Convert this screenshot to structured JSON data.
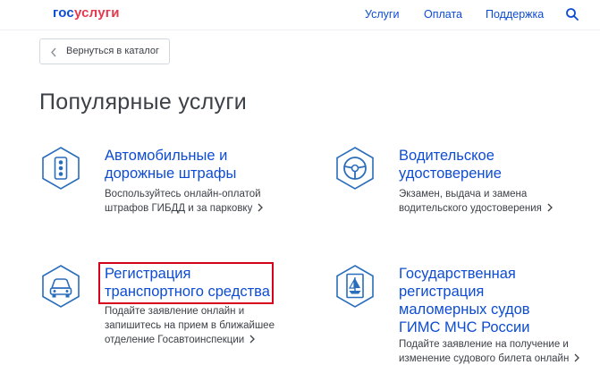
{
  "header": {
    "logo_part1": "гос",
    "logo_part2": "услуги",
    "nav": [
      "Услуги",
      "Оплата",
      "Поддержка"
    ]
  },
  "back_button": {
    "label": "Вернуться в каталог"
  },
  "page_title": "Популярные услуги",
  "services": [
    {
      "icon": "traffic-light-icon",
      "title_lines": [
        "Автомобильные и",
        "дорожные штрафы"
      ],
      "desc_lines": [
        "Воспользуйтесь онлайн-оплатой",
        "штрафов ГИБДД и за парковку"
      ]
    },
    {
      "icon": "steering-wheel-icon",
      "title_lines": [
        "Водительское",
        "удостоверение"
      ],
      "desc_lines": [
        "Экзамен, выдача и замена",
        "водительского удостоверения"
      ]
    },
    {
      "icon": "car-icon",
      "title_lines": [
        "Регистрация",
        "транспортного средства"
      ],
      "desc_lines": [
        "Подайте заявление онлайн и",
        "запишитесь на прием в ближайшее",
        "отделение Госавтоинспекции"
      ]
    },
    {
      "icon": "boat-document-icon",
      "title_lines": [
        "Государственная",
        "регистрация",
        "маломерных судов",
        "ГИМС МЧС России"
      ],
      "desc_lines": [
        "Подайте заявление на получение и",
        "изменение судового билета онлайн"
      ]
    }
  ],
  "colors": {
    "brand_blue": "#0d4cd3",
    "brand_red": "#e5394f",
    "highlight": "#d6001c",
    "text": "#3c4148"
  }
}
